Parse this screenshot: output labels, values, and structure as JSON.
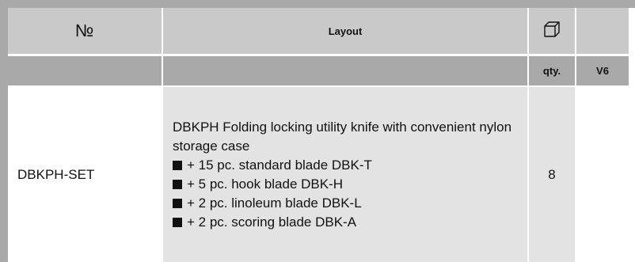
{
  "header": {
    "number_label": "№",
    "layout_label": "Layout",
    "box_icon": "box-icon"
  },
  "subheader": {
    "qty_label": "qty.",
    "v6_label": "V6"
  },
  "rows": [
    {
      "code": "DBKPH-SET",
      "description": "DBKPH Folding locking utility knife with convenient nylon storage case",
      "items": [
        "+ 15 pc. standard blade DBK-T",
        "+ 5 pc. hook blade DBK-H",
        "+ 2 pc. linoleum blade DBK-L",
        "+ 2 pc. scoring blade DBK-A"
      ],
      "qty": "8",
      "v6": ""
    }
  ]
}
